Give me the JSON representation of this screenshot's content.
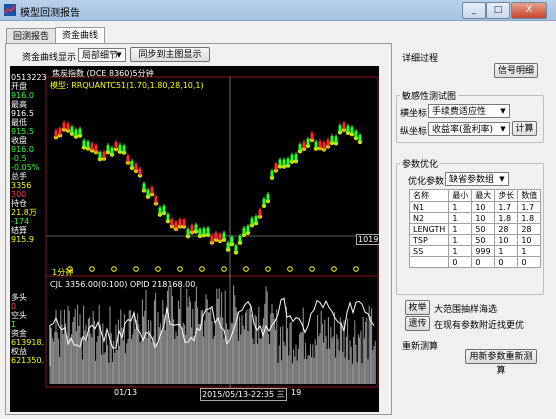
{
  "window": {
    "title": "模型回测报告",
    "controls": [
      "_",
      "□",
      "X"
    ]
  },
  "tabs": [
    {
      "label": "回测报告",
      "active": false
    },
    {
      "label": "资金曲线",
      "active": true
    }
  ],
  "toolbar": {
    "display_label": "资金曲线显示",
    "display_value": "局部细节",
    "sync_button": "同步到主图显示"
  },
  "chart": {
    "header": "焦炭指数 (DCE 8360)5分钟",
    "model_label": "模型: RRQUANTC51(1.70,1.80,28,10,1)",
    "price_label": "1019.0",
    "period_label": "1分钟",
    "indicator_line": "CJL    3356.00(0:100)    OPID 218168.00",
    "date_label": "01/13",
    "cursor_time": "2015/05/13-22:35 三",
    "cursor_right": "19",
    "quote": [
      {
        "t": "0513223",
        "c": "white"
      },
      {
        "t": "开盘",
        "c": "white"
      },
      {
        "t": "916.0",
        "c": "green"
      },
      {
        "t": "最高",
        "c": "white"
      },
      {
        "t": "916.5",
        "c": "white"
      },
      {
        "t": "最低",
        "c": "white"
      },
      {
        "t": "915.5",
        "c": "green"
      },
      {
        "t": "收盘",
        "c": "white"
      },
      {
        "t": "916.0",
        "c": "green"
      },
      {
        "t": "-0.5",
        "c": "green"
      },
      {
        "t": "-0.05%",
        "c": "green"
      },
      {
        "t": "总手",
        "c": "white"
      },
      {
        "t": "3356",
        "c": "yellow"
      },
      {
        "t": "300",
        "c": "red"
      },
      {
        "t": "持仓",
        "c": "white"
      },
      {
        "t": "21.8万",
        "c": "yellow"
      },
      {
        "t": "-174",
        "c": "green"
      },
      {
        "t": "结算",
        "c": "white"
      },
      {
        "t": "915.9",
        "c": "yellow"
      },
      {
        "t": "多头",
        "c": "white"
      },
      {
        "t": "0",
        "c": "red"
      },
      {
        "t": "空头",
        "c": "white"
      },
      {
        "t": "1",
        "c": "green"
      },
      {
        "t": "资金",
        "c": "white"
      },
      {
        "t": "613918.",
        "c": "yellow"
      },
      {
        "t": "权益",
        "c": "white"
      },
      {
        "t": "621350.",
        "c": "yellow"
      }
    ],
    "colors": {
      "bg": "#000000",
      "up": "#ff2020",
      "down": "#20ff20",
      "ma": "#ffff00",
      "equity": "#ffffff"
    }
  },
  "right": {
    "detail_title": "详细过程",
    "signal_button": "信号明细",
    "sensitivity_title": "敏感性测试图",
    "x_label": "横坐标",
    "x_value": "手续费适应性",
    "y_label": "纵坐标",
    "y_value": "收益率(盈利率)",
    "calc_button": "计算",
    "opt_title": "参数优化",
    "opt_label": "优化参数",
    "opt_value": "缺省参数组",
    "table_headers": [
      "名称",
      "最小",
      "最大",
      "步长",
      "数值"
    ],
    "table_rows": [
      [
        "N1",
        "1",
        "10",
        "1.7",
        "1.7"
      ],
      [
        "N2",
        "1",
        "10",
        "1.8",
        "1.8"
      ],
      [
        "LENGTH",
        "1",
        "50",
        "28",
        "28"
      ],
      [
        "TSP",
        "1",
        "50",
        "10",
        "10"
      ],
      [
        "SS",
        "1",
        "999",
        "1",
        "1"
      ],
      [
        "",
        "0",
        "0",
        "0",
        "0"
      ]
    ],
    "exhaust_button": "枚举",
    "exhaust_text": "大范围抽样海选",
    "iter_button": "遗传",
    "iter_text": "在现有参数附近找更优",
    "retest_title": "重新测算",
    "retest_button": "用新参数重新测算"
  }
}
